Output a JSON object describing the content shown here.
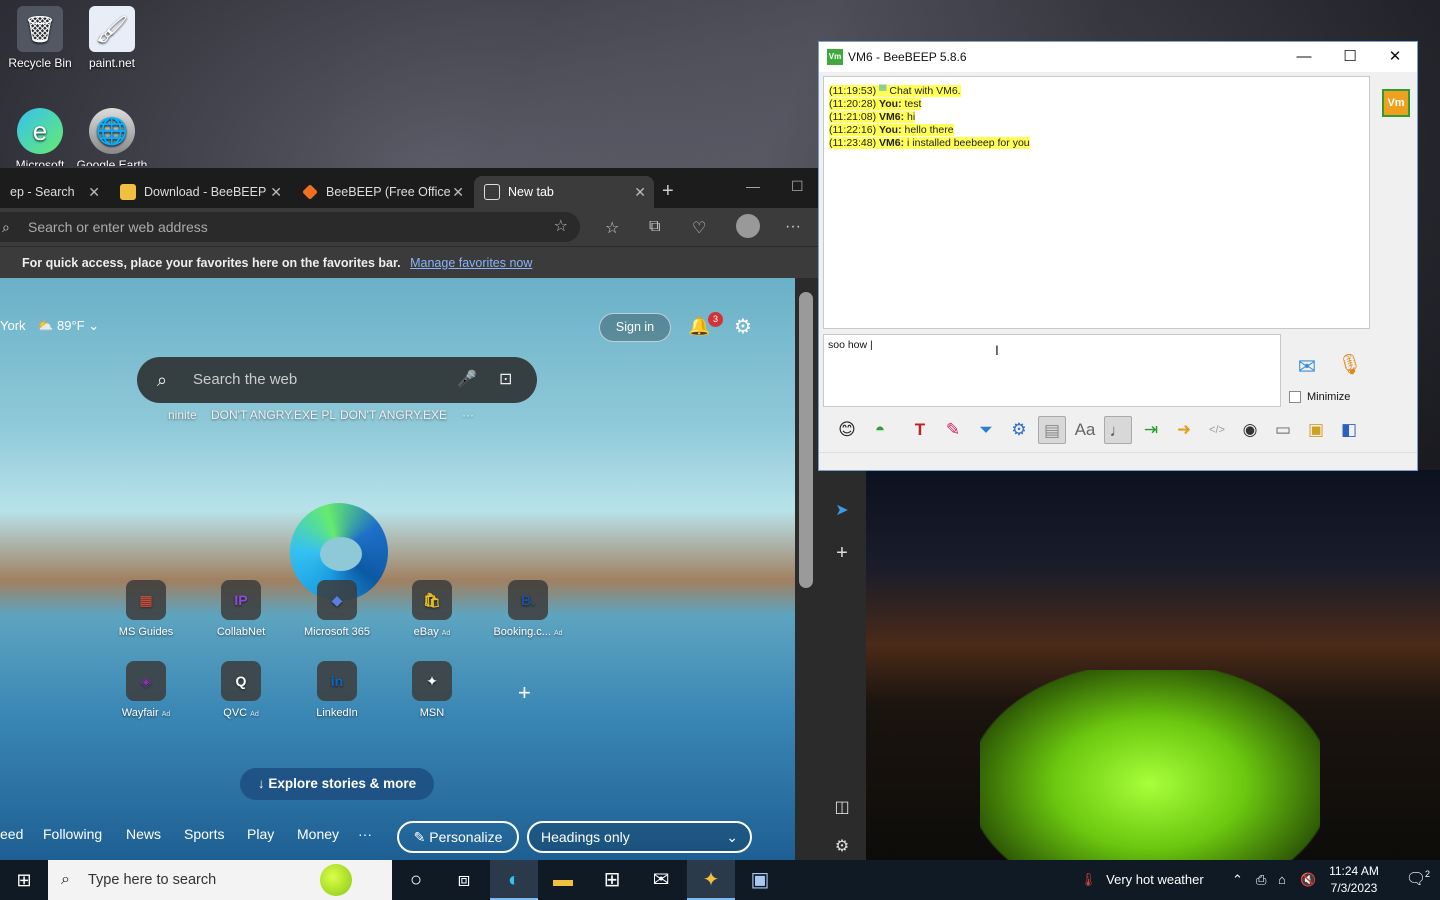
{
  "desktop": {
    "icons": [
      {
        "label": "Recycle Bin",
        "glyph": "🗑"
      },
      {
        "label": "paint.net",
        "glyph": "🖌"
      },
      {
        "label": "Microsoft Edge",
        "glyph": "e"
      },
      {
        "label": "Google Earth Pro",
        "glyph": "🌐"
      }
    ]
  },
  "edge": {
    "tabs": [
      {
        "label": "ep - Search"
      },
      {
        "label": "Download - BeeBEEP"
      },
      {
        "label": "BeeBEEP (Free Office"
      },
      {
        "label": "New tab"
      }
    ],
    "address_placeholder": "Search or enter web address",
    "favbar": {
      "text": "For quick access, place your favorites here on the favorites bar.",
      "link": "Manage favorites now"
    },
    "ntp": {
      "weather_city": "York",
      "weather_temp": "89°F",
      "sign_in": "Sign in",
      "notif_count": "3",
      "search_placeholder": "Search the web",
      "suggestions": [
        "ninite",
        "DON'T ANGRY.EXE PL",
        "DON'T ANGRY.EXE",
        "···"
      ],
      "tiles": [
        {
          "label": "MS Guides",
          "ad": "",
          "glyph": "▦",
          "color": "#e0533a"
        },
        {
          "label": "CollabNet",
          "ad": "",
          "glyph": "IP",
          "color": "#8a4bd8"
        },
        {
          "label": "Microsoft 365",
          "ad": "",
          "glyph": "◆",
          "color": "#5a7fe0"
        },
        {
          "label": "eBay",
          "ad": "Ad",
          "glyph": "🛍",
          "color": "#e8c020"
        },
        {
          "label": "Booking.c...",
          "ad": "Ad",
          "glyph": "B.",
          "color": "#1d4fa0"
        },
        {
          "label": "Wayfair",
          "ad": "Ad",
          "glyph": "◈",
          "color": "#7a3aa0"
        },
        {
          "label": "QVC",
          "ad": "Ad",
          "glyph": "Q",
          "color": "#ffffff"
        },
        {
          "label": "LinkedIn",
          "ad": "",
          "glyph": "in",
          "color": "#0a66c2"
        },
        {
          "label": "MSN",
          "ad": "",
          "glyph": "✦",
          "color": "#ffffff"
        }
      ],
      "explore": "Explore stories & more",
      "feed_items": [
        "eed",
        "Following",
        "News",
        "Sports",
        "Play",
        "Money",
        "···"
      ],
      "personalize": "Personalize",
      "headings": "Headings only"
    }
  },
  "beebeep": {
    "title": "VM6 - BeeBEEP 5.8.6",
    "app_badge": "Vm",
    "chat": [
      {
        "time": "(11:19:53)",
        "who": "",
        "text": "Chat with VM6."
      },
      {
        "time": "(11:20:28)",
        "who": "You:",
        "text": "test"
      },
      {
        "time": "(11:21:08)",
        "who": "VM6:",
        "text": "hi"
      },
      {
        "time": "(11:22:16)",
        "who": "You:",
        "text": "hello there"
      },
      {
        "time": "(11:23:48)",
        "who": "VM6:",
        "text": "i installed beebeep for you"
      }
    ],
    "input_value": "soo how |",
    "minimize_label": "Minimize",
    "toolbar_icons": [
      "smiley-icon",
      "chat-icon",
      "font-icon",
      "color-icon",
      "filter-icon",
      "settings-icon",
      "save-icon",
      "font-size-icon",
      "sound-icon",
      "send-file-icon",
      "send-folder-icon",
      "code-icon",
      "screenshot-icon",
      "window-icon",
      "clipboard-icon",
      "history-icon"
    ]
  },
  "taskbar": {
    "search_placeholder": "Type here to search",
    "weather": "Very hot weather",
    "time": "11:24 AM",
    "date": "7/3/2023",
    "notif_count": "2"
  }
}
